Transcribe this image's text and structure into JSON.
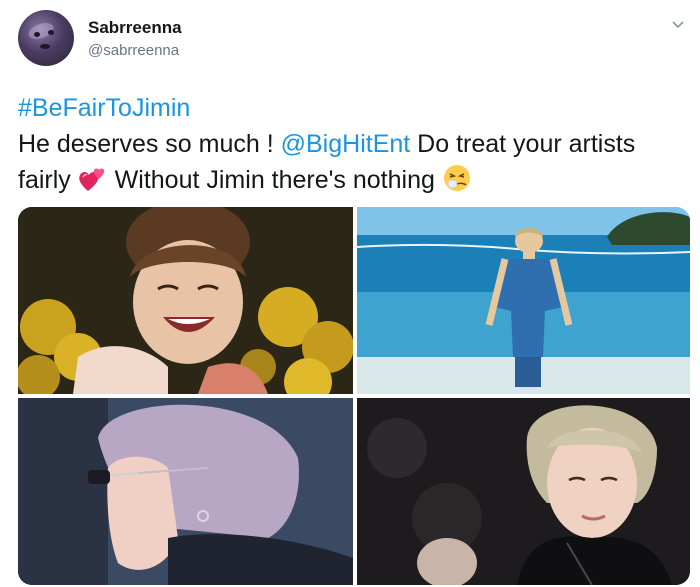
{
  "author": {
    "display_name": "Sabrreenna",
    "handle": "@sabrreenna"
  },
  "tweet": {
    "hashtag": "#BeFairToJimin",
    "line1_prefix": "He deserves so much ! ",
    "mention": "@BigHitEnt",
    "line1_suffix": " Do treat your artists",
    "line2_a": "fairly ",
    "line2_b": " Without Jimin there's nothing "
  },
  "icons": {
    "chevron": "chevron-down-icon",
    "emoji_1": "two-hearts-emoji",
    "emoji_2": "sneezing-face-emoji"
  },
  "colors": {
    "link": "#1b95e0",
    "text": "#14171a",
    "secondary": "#657786"
  },
  "media": {
    "photos": [
      "photo-1",
      "photo-2",
      "photo-3",
      "photo-4"
    ]
  }
}
